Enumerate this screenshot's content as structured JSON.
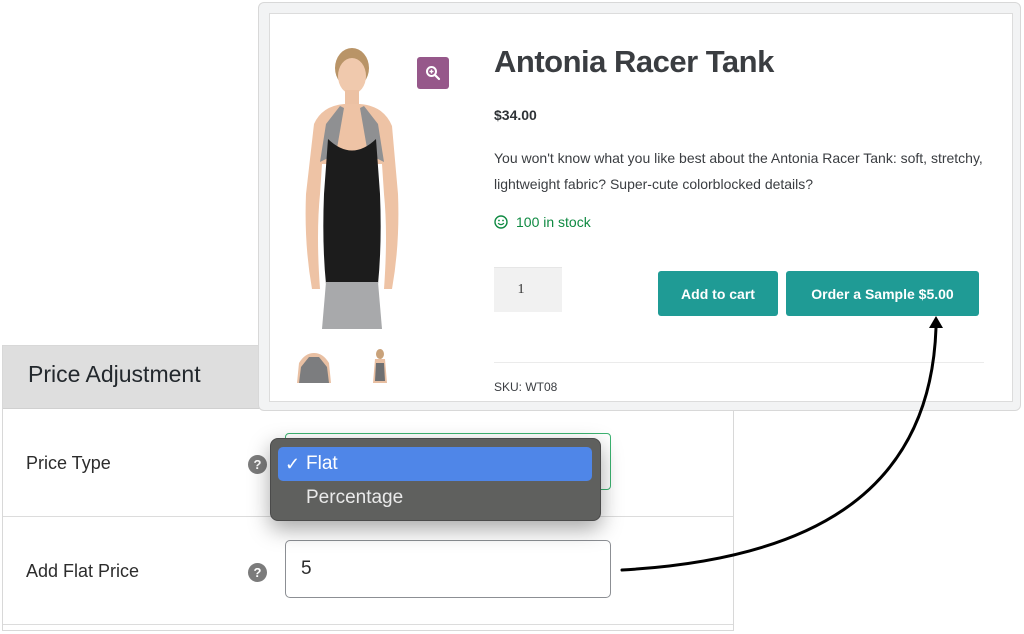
{
  "product": {
    "title": "Antonia Racer Tank",
    "price": "$34.00",
    "description": "You won't know what you like best about the Antonia Racer Tank: soft, stretchy, lightweight fabric? Super-cute colorblocked details?",
    "stock_text": "100 in stock",
    "stock_icon": "smiley-icon",
    "quantity": "1",
    "add_to_cart_label": "Add to cart",
    "order_sample_label": "Order a Sample $5.00",
    "sku_text": "SKU: WT08",
    "zoom_icon": "magnifier-plus-icon",
    "thumbnails": [
      "thumbnail-front",
      "thumbnail-back"
    ],
    "colors": {
      "button": "#1f9b95",
      "zoom_button": "#96588a",
      "stock": "#0f8a42"
    }
  },
  "admin": {
    "section_title": "Price Adjustment",
    "fields": [
      {
        "label": "Price Type",
        "help": "?",
        "value": "Flat"
      },
      {
        "label": "Add Flat Price",
        "help": "?",
        "value": "5"
      }
    ],
    "dropdown": {
      "options": [
        {
          "label": "Flat",
          "selected": true,
          "check": "✓"
        },
        {
          "label": "Percentage",
          "selected": false,
          "check": ""
        }
      ],
      "highlight_color": "#4f86e8"
    }
  },
  "annotation": {
    "arrow": "from-flat-price-input-to-order-sample-button"
  }
}
